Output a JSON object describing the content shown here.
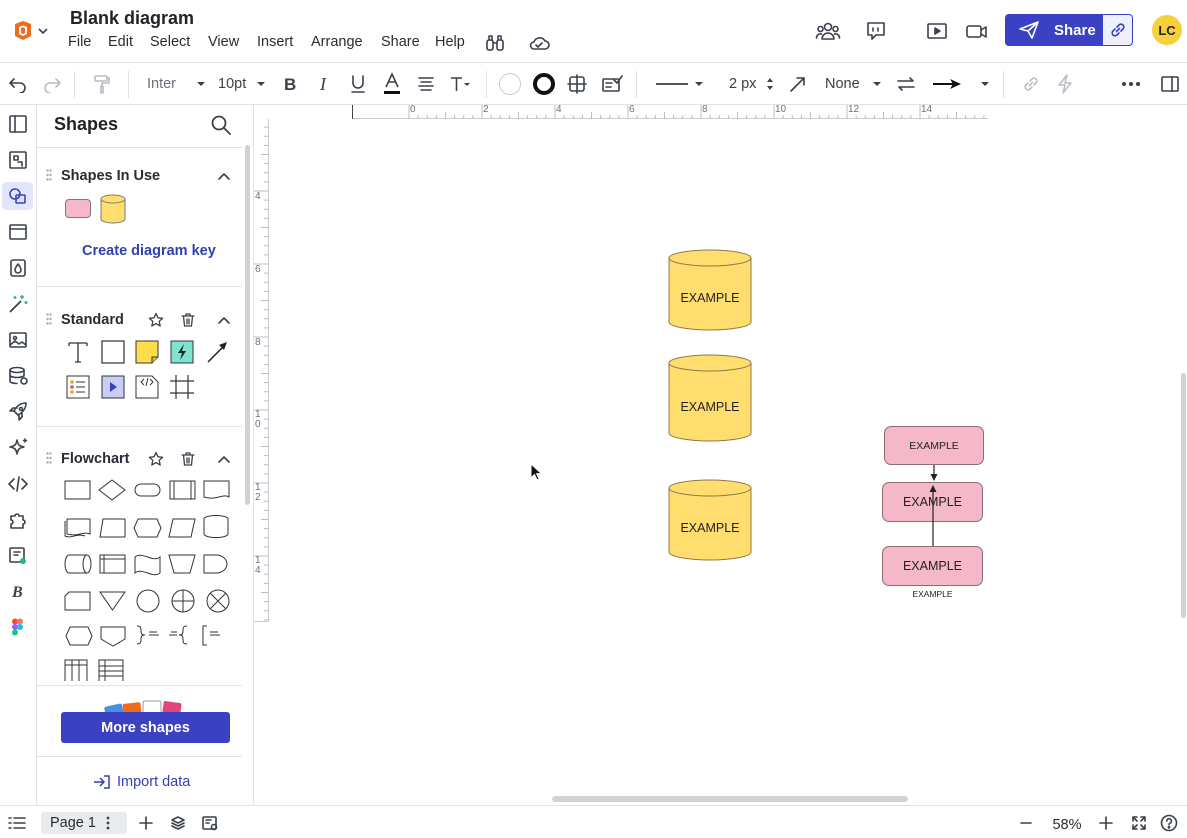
{
  "app": {
    "title": "Blank diagram",
    "user_initials": "LC",
    "share_label": "Share"
  },
  "menu": [
    "File",
    "Edit",
    "Select",
    "View",
    "Insert",
    "Arrange",
    "Share",
    "Help"
  ],
  "toolbar": {
    "font": "Inter",
    "font_size": "10pt",
    "line_width": "2 px",
    "line_end": "None"
  },
  "panel": {
    "title": "Shapes",
    "sections": {
      "in_use": "Shapes In Use",
      "standard": "Standard",
      "flowchart": "Flowchart"
    },
    "create_key": "Create diagram key",
    "more_shapes": "More shapes",
    "import_data": "Import data"
  },
  "ruler": {
    "h": [
      "0",
      "2",
      "4",
      "6",
      "8",
      "10",
      "12",
      "14"
    ],
    "v": [
      "4",
      "6",
      "8",
      "10",
      "12",
      "14"
    ]
  },
  "canvas": {
    "databases": [
      "EXAMPLE",
      "EXAMPLE",
      "EXAMPLE"
    ],
    "pink_boxes": [
      "EXAMPLE",
      "EXAMPLE",
      "EXAMPLE"
    ],
    "caption": "EXAMPLE"
  },
  "bottom": {
    "page": "Page 1",
    "zoom": "58%"
  },
  "colors": {
    "accent": "#3a41c2",
    "db_fill": "#ffdd6e",
    "pink_fill": "#f5b8c8",
    "avatar": "#f7d03a"
  }
}
